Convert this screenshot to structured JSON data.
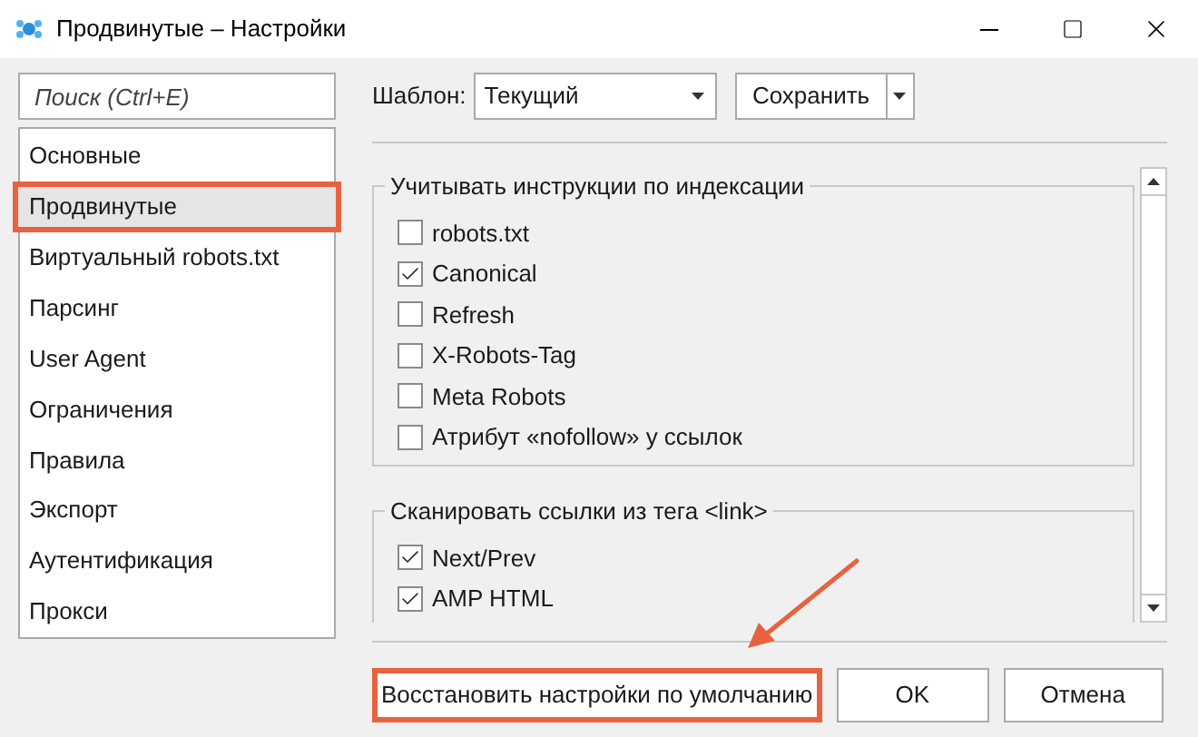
{
  "window": {
    "title": "Продвинутые – Настройки"
  },
  "search": {
    "placeholder": "Поиск (Ctrl+E)"
  },
  "sidebar": {
    "items": [
      {
        "label": "Основные",
        "selected": false,
        "highlighted": false
      },
      {
        "label": "Продвинутые",
        "selected": true,
        "highlighted": true
      },
      {
        "label": "Виртуальный robots.txt",
        "selected": false,
        "highlighted": false
      },
      {
        "label": "Парсинг",
        "selected": false,
        "highlighted": false
      },
      {
        "label": "User Agent",
        "selected": false,
        "highlighted": false
      },
      {
        "label": "Ограничения",
        "selected": false,
        "highlighted": false
      },
      {
        "label": "Правила",
        "selected": false,
        "highlighted": false
      },
      {
        "label": "Экспорт",
        "selected": false,
        "highlighted": false
      },
      {
        "label": "Аутентификация",
        "selected": false,
        "highlighted": false
      },
      {
        "label": "Прокси",
        "selected": false,
        "highlighted": false
      }
    ]
  },
  "template": {
    "label": "Шаблон:",
    "value": "Текущий"
  },
  "save_button": {
    "label": "Сохранить"
  },
  "groups": [
    {
      "title": "Учитывать инструкции по индексации",
      "items": [
        {
          "label": "robots.txt",
          "checked": false
        },
        {
          "label": "Canonical",
          "checked": true
        },
        {
          "label": "Refresh",
          "checked": false
        },
        {
          "label": "X-Robots-Tag",
          "checked": false
        },
        {
          "label": "Meta Robots",
          "checked": false
        },
        {
          "label": "Атрибут «nofollow» у ссылок",
          "checked": false
        }
      ]
    },
    {
      "title": "Сканировать ссылки из тега <link>",
      "items": [
        {
          "label": "Next/Prev",
          "checked": true
        },
        {
          "label": "AMP HTML",
          "checked": true
        }
      ]
    }
  ],
  "buttons": [
    {
      "label": "Восстановить настройки по умолчанию",
      "highlighted": true
    },
    {
      "label": "OK",
      "highlighted": false
    },
    {
      "label": "Отмена",
      "highlighted": false
    }
  ]
}
